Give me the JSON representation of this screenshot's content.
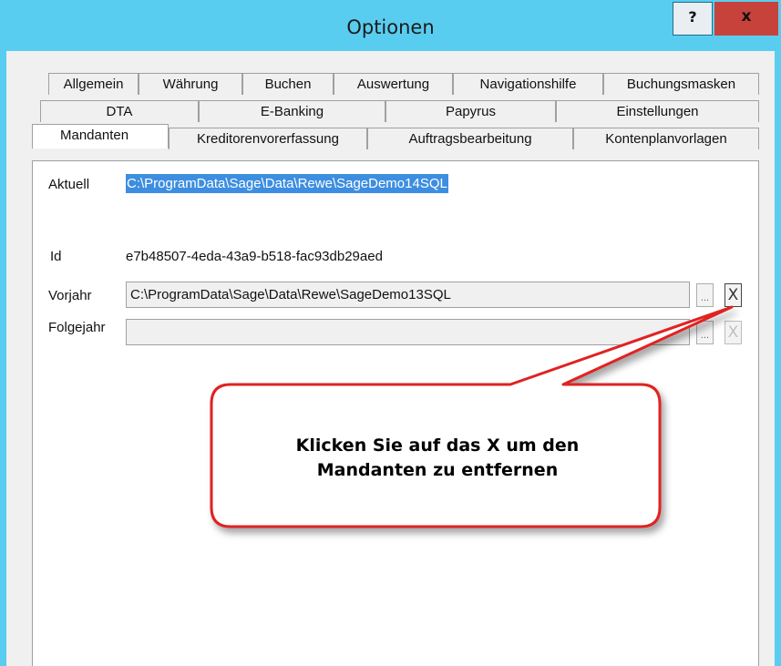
{
  "window": {
    "title": "Optionen",
    "help_label": "?",
    "close_label": "x"
  },
  "tabs": {
    "row1": [
      "Allgemein",
      "Währung",
      "Buchen",
      "Auswertung",
      "Navigationshilfe",
      "Buchungsmasken"
    ],
    "row2": [
      "DTA",
      "E-Banking",
      "Papyrus",
      "Einstellungen"
    ],
    "row3": [
      "Mandanten",
      "Kreditorenvorerfassung",
      "Auftragsbearbeitung",
      "Kontenplanvorlagen"
    ],
    "active": "Mandanten"
  },
  "mandanten": {
    "aktuell_label": "Aktuell",
    "aktuell_value": "C:\\ProgramData\\Sage\\Data\\Rewe\\SageDemo14SQL",
    "id_label": "Id",
    "id_value": "e7b48507-4eda-43a9-b518-fac93db29aed",
    "vorjahr_label": "Vorjahr",
    "vorjahr_value": "C:\\ProgramData\\Sage\\Data\\Rewe\\SageDemo13SQL",
    "folgejahr_label": "Folgejahr",
    "folgejahr_value": "",
    "browse_label": "...",
    "remove_label": "X"
  },
  "callout": {
    "line1": "Klicken Sie auf das X um den",
    "line2": "Mandanten zu entfernen",
    "border_color": "#e02020"
  },
  "colors": {
    "titlebar": "#59cdf0",
    "close_button": "#c7423a",
    "selection": "#3d8ee0"
  }
}
